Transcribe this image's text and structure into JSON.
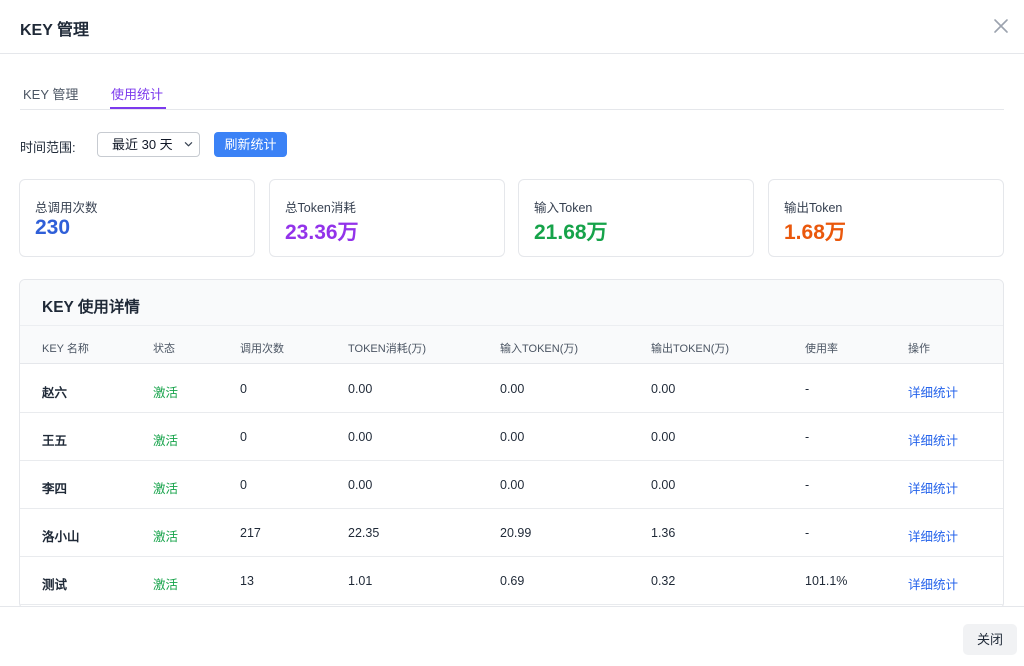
{
  "modal": {
    "title": "KEY 管理",
    "close_label": "关闭"
  },
  "tabs": [
    {
      "label": "KEY 管理",
      "active": false
    },
    {
      "label": "使用统计",
      "active": true
    }
  ],
  "filter": {
    "label": "时间范围:",
    "selected": "最近 30 天",
    "refresh_label": "刷新统计"
  },
  "stats": [
    {
      "label": "总调用次数",
      "value": "230",
      "color": "#2f5fd8"
    },
    {
      "label": "总Token消耗",
      "value": "23.36万",
      "color": "#9333ea"
    },
    {
      "label": "输入Token",
      "value": "21.68万",
      "color": "#16a34a"
    },
    {
      "label": "输出Token",
      "value": "1.68万",
      "color": "#ea580c"
    }
  ],
  "detail": {
    "title": "KEY 使用详情",
    "columns": [
      "KEY 名称",
      "状态",
      "调用次数",
      "TOKEN消耗(万)",
      "输入TOKEN(万)",
      "输出TOKEN(万)",
      "使用率",
      "操作"
    ],
    "rows": [
      {
        "name": "赵六",
        "status": "激活",
        "calls": "0",
        "total": "0.00",
        "input": "0.00",
        "output": "0.00",
        "rate": "-",
        "action": "详细统计"
      },
      {
        "name": "王五",
        "status": "激活",
        "calls": "0",
        "total": "0.00",
        "input": "0.00",
        "output": "0.00",
        "rate": "-",
        "action": "详细统计"
      },
      {
        "name": "李四",
        "status": "激活",
        "calls": "0",
        "total": "0.00",
        "input": "0.00",
        "output": "0.00",
        "rate": "-",
        "action": "详细统计"
      },
      {
        "name": "洛小山",
        "status": "激活",
        "calls": "217",
        "total": "22.35",
        "input": "20.99",
        "output": "1.36",
        "rate": "-",
        "action": "详细统计"
      },
      {
        "name": "测试",
        "status": "激活",
        "calls": "13",
        "total": "1.01",
        "input": "0.69",
        "output": "0.32",
        "rate": "101.1%",
        "action": "详细统计"
      }
    ]
  },
  "icons": {
    "close": "close-icon",
    "select_arrow": "chevron-down-icon"
  }
}
